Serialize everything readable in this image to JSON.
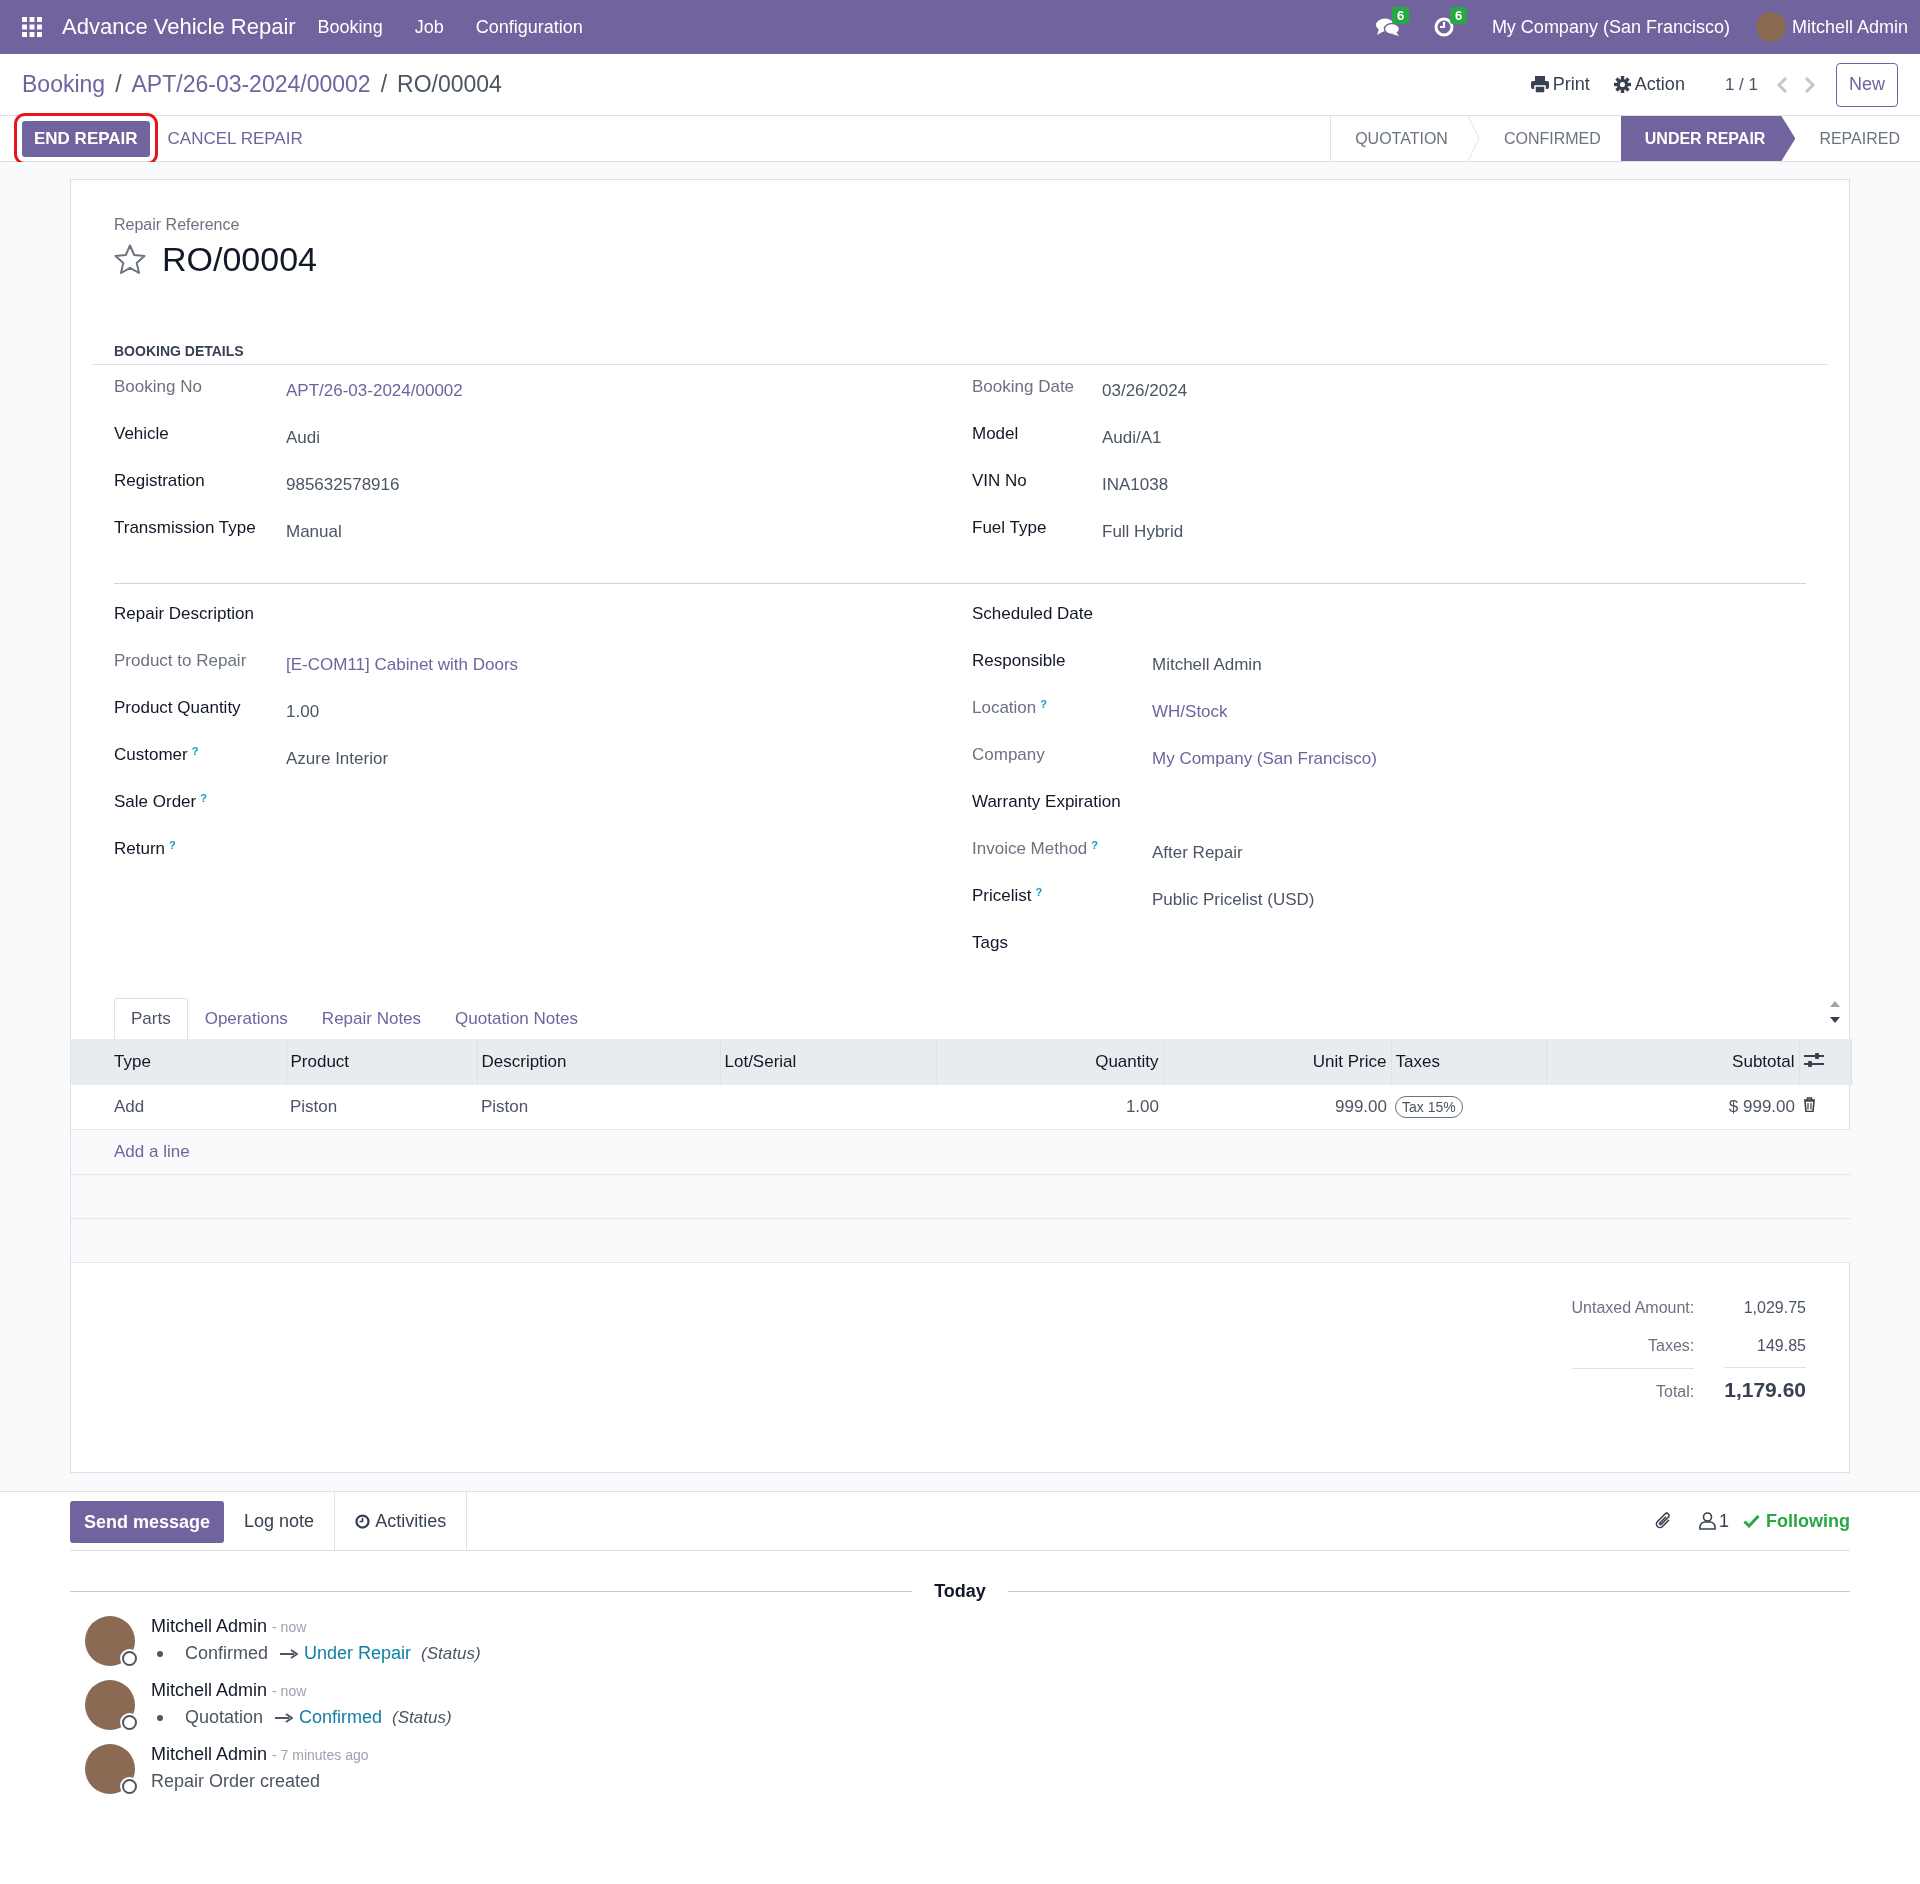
{
  "navbar": {
    "app_name": "Advance Vehicle Repair",
    "menus": [
      "Booking",
      "Job",
      "Configuration"
    ],
    "messages_badge": "6",
    "activities_badge": "6",
    "company": "My Company (San Francisco)",
    "user": "Mitchell Admin"
  },
  "breadcrumbs": [
    {
      "label": "Booking",
      "separator": "/",
      "current": false
    },
    {
      "label": "APT/26-03-2024/00002",
      "separator": "/",
      "current": false
    },
    {
      "label": "RO/00004",
      "current": true
    }
  ],
  "toolbar": {
    "print": "Print",
    "action": "Action",
    "pager": "1 / 1",
    "new": "New"
  },
  "header_buttons": [
    {
      "label": "END REPAIR",
      "primary": true,
      "highlighted": true
    },
    {
      "label": "CANCEL REPAIR",
      "primary": false,
      "highlighted": false
    }
  ],
  "stages": [
    {
      "label": "QUOTATION",
      "selected": false
    },
    {
      "label": "CONFIRMED",
      "selected": false
    },
    {
      "label": "UNDER REPAIR",
      "selected": true
    },
    {
      "label": "REPAIRED",
      "selected": false
    }
  ],
  "record": {
    "caption": "Repair Reference",
    "title": "RO/00004",
    "starred": false
  },
  "booking_details": {
    "title": "BOOKING DETAILS",
    "left": [
      {
        "label": "Booking No",
        "strong": false,
        "value": "APT/26-03-2024/00002",
        "link": true
      },
      {
        "label": "Vehicle",
        "strong": true,
        "value": "Audi",
        "link": false
      },
      {
        "label": "Registration",
        "strong": true,
        "value": "985632578916",
        "link": false
      },
      {
        "label": "Transmission Type",
        "strong": true,
        "value": "Manual",
        "link": false
      }
    ],
    "right": [
      {
        "label": "Booking Date",
        "strong": false,
        "value": "03/26/2024",
        "link": false
      },
      {
        "label": "Model",
        "strong": true,
        "value": "Audi/A1",
        "link": false
      },
      {
        "label": "VIN No",
        "strong": true,
        "value": "INA1038",
        "link": false
      },
      {
        "label": "Fuel Type",
        "strong": true,
        "value": "Full Hybrid",
        "link": false
      }
    ]
  },
  "repair_details": {
    "left": [
      {
        "label": "Repair Description",
        "strong": true
      },
      {
        "label": "Product to Repair",
        "strong": false,
        "value": "[E-COM11] Cabinet with Doors",
        "link": true
      },
      {
        "label": "Product Quantity",
        "strong": true,
        "value": "1.00",
        "link": false
      },
      {
        "label": "Customer",
        "strong": true,
        "help": "?",
        "value": "Azure Interior",
        "link": false
      },
      {
        "label": "Sale Order",
        "strong": true,
        "help": "?"
      },
      {
        "label": "Return",
        "strong": true,
        "help": "?"
      }
    ],
    "right": [
      {
        "label": "Scheduled Date",
        "strong": true
      },
      {
        "label": "Responsible",
        "strong": true,
        "value": "Mitchell Admin",
        "link": false
      },
      {
        "label": "Location",
        "strong": false,
        "help": "?",
        "value": "WH/Stock",
        "link": true
      },
      {
        "label": "Company",
        "strong": false,
        "value": "My Company (San Francisco)",
        "link": true
      },
      {
        "label": "Warranty Expiration",
        "strong": true
      },
      {
        "label": "Invoice Method",
        "strong": false,
        "help": "?",
        "value": "After Repair",
        "link": false
      },
      {
        "label": "Pricelist",
        "strong": true,
        "help": "?",
        "value": "Public Pricelist (USD)",
        "link": false
      },
      {
        "label": "Tags",
        "strong": true
      }
    ]
  },
  "tabs": [
    {
      "label": "Parts",
      "selected": true
    },
    {
      "label": "Operations",
      "selected": false
    },
    {
      "label": "Repair Notes",
      "selected": false
    },
    {
      "label": "Quotation Notes",
      "selected": false
    }
  ],
  "parts_table": {
    "columns": [
      {
        "label": "Type",
        "numeric": false
      },
      {
        "label": "Product",
        "numeric": false
      },
      {
        "label": "Description",
        "numeric": false
      },
      {
        "label": "Lot/Serial",
        "numeric": false
      },
      {
        "label": "Quantity",
        "numeric": true
      },
      {
        "label": "Unit Price",
        "numeric": true
      },
      {
        "label": "Taxes",
        "numeric": false
      },
      {
        "label": "Subtotal",
        "numeric": true
      }
    ],
    "rows": [
      {
        "cells": [
          "Add",
          "Piston",
          "Piston",
          null,
          "1.00",
          "999.00",
          {
            "tags": [
              "Tax 15%"
            ]
          },
          "$ 999.00"
        ]
      }
    ],
    "add_line": "Add a line"
  },
  "totals": [
    {
      "label": "Untaxed Amount:",
      "value": "1,029.75",
      "grand": false
    },
    {
      "label": "Taxes:",
      "value": "149.85",
      "grand": false
    },
    {
      "label": "Total:",
      "value": "1,179.60",
      "grand": true
    }
  ],
  "chatter": {
    "buttons": [
      {
        "label": "Send message",
        "kind": "primary"
      },
      {
        "label": "Log note",
        "kind": "plain"
      },
      {
        "label": "Activities",
        "kind": "activities"
      }
    ],
    "followers": "1",
    "following": "Following",
    "date_separator": "Today",
    "messages": [
      {
        "author": "Mitchell Admin",
        "time": "- now",
        "kind": "tracking",
        "old": "Confirmed",
        "new": "Under Repair",
        "field": "(Status)"
      },
      {
        "author": "Mitchell Admin",
        "time": "- now",
        "kind": "tracking",
        "old": "Quotation",
        "new": "Confirmed",
        "field": "(Status)"
      },
      {
        "author": "Mitchell Admin",
        "time": "- 7 minutes ago",
        "kind": "note",
        "body": "Repair Order created"
      }
    ]
  }
}
